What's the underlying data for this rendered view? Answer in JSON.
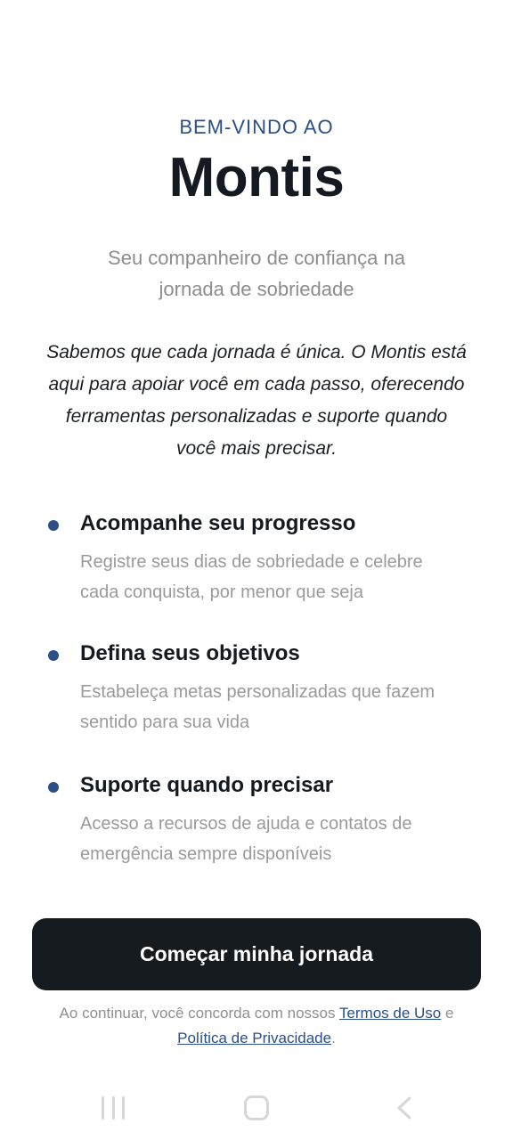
{
  "welcome": {
    "eyebrow": "BEM-VINDO AO",
    "app_name": "Montis",
    "subtitle_line1": "Seu companheiro de confiança na",
    "subtitle_line2": "jornada de sobriedade",
    "intro_line1": "Sabemos que cada jornada é única. O Montis está",
    "intro_line2": "aqui para apoiar você em cada passo, oferecendo",
    "intro_line3": "ferramentas personalizadas e suporte quando",
    "intro_line4": "você mais precisar."
  },
  "features": [
    {
      "title": "Acompanhe seu progresso",
      "desc_line1": "Registre seus dias de sobriedade e celebre",
      "desc_line2": "cada conquista, por menor que seja"
    },
    {
      "title": "Defina seus objetivos",
      "desc_line1": "Estabeleça metas personalizadas que fazem",
      "desc_line2": "sentido para sua vida"
    },
    {
      "title": "Suporte quando precisar",
      "desc_line1": "Acesso a recursos de ajuda e contatos de",
      "desc_line2": "emergência sempre disponíveis"
    }
  ],
  "cta": {
    "label": "Começar minha jornada"
  },
  "legal": {
    "prefix": "Ao continuar, você concorda com nossos ",
    "terms_link": "Termos de Uso",
    "conjunction": " e",
    "privacy_link": "Política de Privacidade",
    "suffix": "."
  },
  "navbar": {
    "icons": [
      "recent-apps-icon",
      "home-icon",
      "back-icon"
    ]
  },
  "colors": {
    "accent": "#2b4f86",
    "button_bg": "#161b1f",
    "title": "#141a20",
    "muted": "#8c8c8c"
  }
}
